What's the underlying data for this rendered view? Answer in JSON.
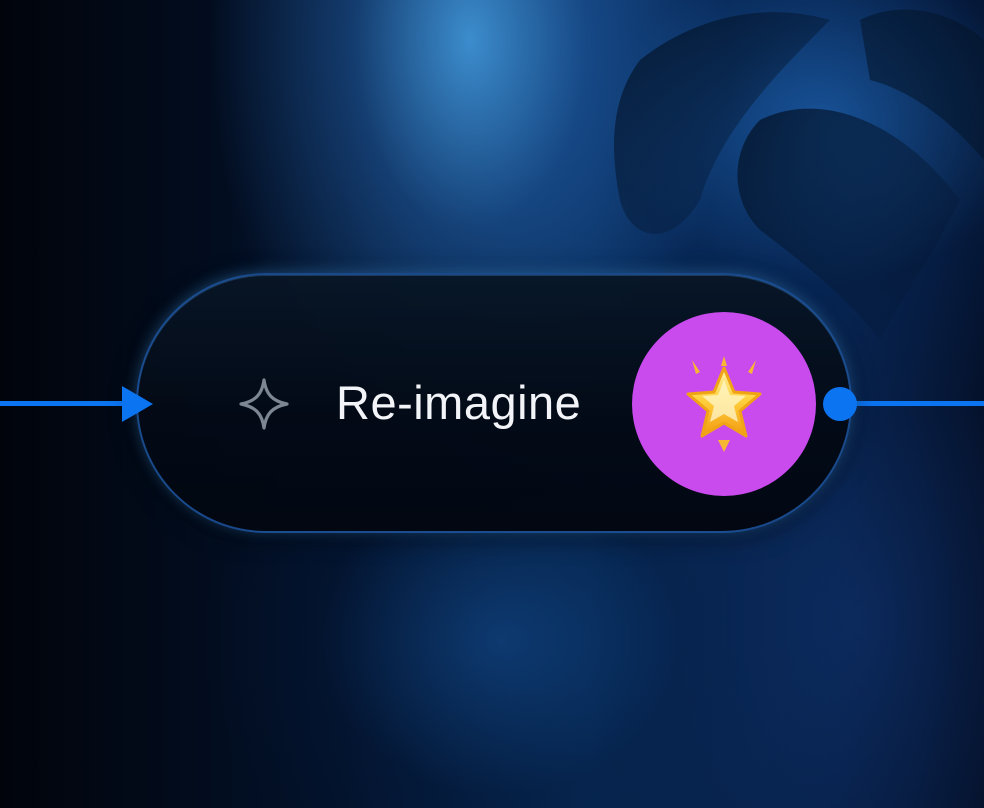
{
  "node": {
    "label": "Re-imagine",
    "leading_icon": "sparkle-icon",
    "badge_icon": "glowing-star-icon"
  },
  "colors": {
    "connector": "#0b74f0",
    "badge_background": "#c94bee",
    "label_text": "#f2f4f8",
    "pill_border": "#2260b4"
  }
}
